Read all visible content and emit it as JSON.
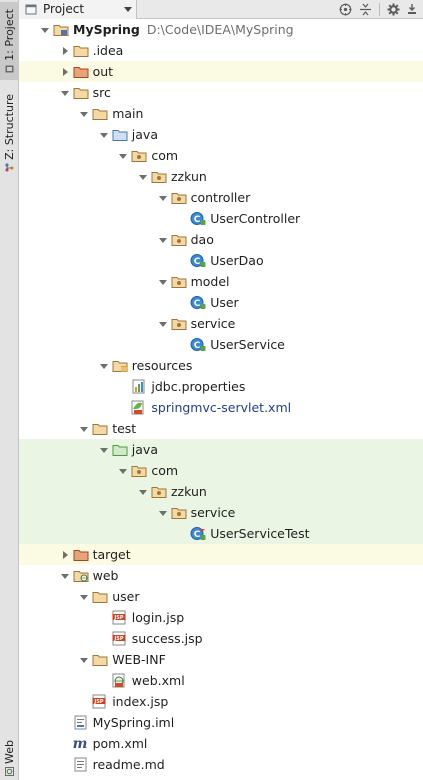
{
  "header": {
    "view_label": "Project"
  },
  "tool_strip": {
    "project_tab": "1: Project",
    "structure_tab": "Z: Structure",
    "web_tab": "Web"
  },
  "tree": [
    {
      "depth": 0,
      "arrow": "down",
      "icon": "module-icon",
      "label": "MySpring",
      "path": "D:\\Code\\IDEA\\MySpring",
      "bold": true
    },
    {
      "depth": 1,
      "arrow": "right",
      "icon": "folder-icon",
      "label": ".idea"
    },
    {
      "depth": 1,
      "arrow": "right",
      "icon": "excluded-folder-icon",
      "label": "out",
      "bg": "yellow"
    },
    {
      "depth": 1,
      "arrow": "down",
      "icon": "folder-icon",
      "label": "src"
    },
    {
      "depth": 2,
      "arrow": "down",
      "icon": "folder-icon",
      "label": "main"
    },
    {
      "depth": 3,
      "arrow": "down",
      "icon": "source-folder-icon",
      "label": "java"
    },
    {
      "depth": 4,
      "arrow": "down",
      "icon": "package-icon",
      "label": "com"
    },
    {
      "depth": 5,
      "arrow": "down",
      "icon": "package-icon",
      "label": "zzkun"
    },
    {
      "depth": 6,
      "arrow": "down",
      "icon": "package-icon",
      "label": "controller"
    },
    {
      "depth": 7,
      "arrow": "none",
      "icon": "class-icon",
      "label": "UserController"
    },
    {
      "depth": 6,
      "arrow": "down",
      "icon": "package-icon",
      "label": "dao"
    },
    {
      "depth": 7,
      "arrow": "none",
      "icon": "class-icon",
      "label": "UserDao"
    },
    {
      "depth": 6,
      "arrow": "down",
      "icon": "package-icon",
      "label": "model"
    },
    {
      "depth": 7,
      "arrow": "none",
      "icon": "class-icon",
      "label": "User"
    },
    {
      "depth": 6,
      "arrow": "down",
      "icon": "package-icon",
      "label": "service"
    },
    {
      "depth": 7,
      "arrow": "none",
      "icon": "class-icon",
      "label": "UserService"
    },
    {
      "depth": 3,
      "arrow": "down",
      "icon": "resources-folder-icon",
      "label": "resources"
    },
    {
      "depth": 4,
      "arrow": "none",
      "icon": "properties-file-icon",
      "label": "jdbc.properties"
    },
    {
      "depth": 4,
      "arrow": "none",
      "icon": "spring-xml-icon",
      "label": "springmvc-servlet.xml",
      "blue": true
    },
    {
      "depth": 2,
      "arrow": "down",
      "icon": "folder-icon",
      "label": "test"
    },
    {
      "depth": 3,
      "arrow": "down",
      "icon": "test-source-folder-icon",
      "label": "java",
      "bg": "green"
    },
    {
      "depth": 4,
      "arrow": "down",
      "icon": "package-icon",
      "label": "com",
      "bg": "green"
    },
    {
      "depth": 5,
      "arrow": "down",
      "icon": "package-icon",
      "label": "zzkun",
      "bg": "green"
    },
    {
      "depth": 6,
      "arrow": "down",
      "icon": "package-icon",
      "label": "service",
      "bg": "green"
    },
    {
      "depth": 7,
      "arrow": "none",
      "icon": "test-class-icon",
      "label": "UserServiceTest",
      "bg": "green"
    },
    {
      "depth": 1,
      "arrow": "right",
      "icon": "excluded-folder-icon",
      "label": "target",
      "bg": "yellow"
    },
    {
      "depth": 1,
      "arrow": "down",
      "icon": "web-folder-icon",
      "label": "web"
    },
    {
      "depth": 2,
      "arrow": "down",
      "icon": "folder-icon",
      "label": "user"
    },
    {
      "depth": 3,
      "arrow": "none",
      "icon": "jsp-file-icon",
      "label": "login.jsp"
    },
    {
      "depth": 3,
      "arrow": "none",
      "icon": "jsp-file-icon",
      "label": "success.jsp"
    },
    {
      "depth": 2,
      "arrow": "down",
      "icon": "folder-icon",
      "label": "WEB-INF"
    },
    {
      "depth": 3,
      "arrow": "none",
      "icon": "web-xml-icon",
      "label": "web.xml"
    },
    {
      "depth": 2,
      "arrow": "none",
      "icon": "jsp-file-icon",
      "label": "index.jsp"
    },
    {
      "depth": 1,
      "arrow": "none",
      "icon": "iml-file-icon",
      "label": "MySpring.iml"
    },
    {
      "depth": 1,
      "arrow": "none",
      "icon": "maven-icon",
      "label": "pom.xml"
    },
    {
      "depth": 1,
      "arrow": "none",
      "icon": "text-file-icon",
      "label": "readme.md"
    }
  ]
}
